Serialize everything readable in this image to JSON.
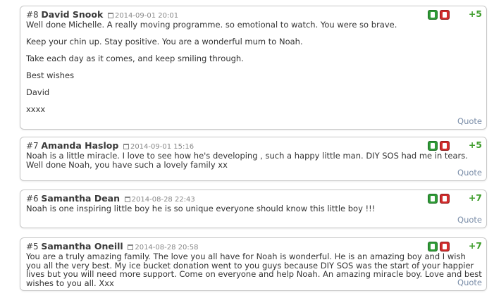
{
  "comments": [
    {
      "number": "#8",
      "author": "David Snook",
      "date": "2014-09-01 20:01",
      "score": "+5",
      "paragraphs": [
        "Well done Michelle. A really moving programme. so emotional to watch. You were so brave.",
        "Keep your chin up. Stay positive. You are a wonderful mum to Noah.",
        "Take each day as it comes, and keep smiling through.",
        "Best wishes",
        "David",
        "xxxx"
      ],
      "quote": "Quote"
    },
    {
      "number": "#7",
      "author": "Amanda Haslop",
      "date": "2014-09-01 15:16",
      "score": "+5",
      "paragraphs": [
        "Noah is a little miracle. I love to see how he's developing , such a happy little man. DIY SOS had me in tears. Well done Noah, you have such a lovely family xx"
      ],
      "quote": "Quote"
    },
    {
      "number": "#6",
      "author": "Samantha Dean",
      "date": "2014-08-28 22:43",
      "score": "+7",
      "paragraphs": [
        "Noah is one inspiring little boy he is so unique everyone should know this little boy !!!"
      ],
      "quote": "Quote"
    },
    {
      "number": "#5",
      "author": "Samantha Oneill",
      "date": "2014-08-28 20:58",
      "score": "+7",
      "paragraphs": [
        "You are a truly amazing family. The love you all have for Noah is wonderful. He is an amazing boy and I wish you all the very best. My ice bucket donation went to you guys because DIY SOS was the start of your happier lives but you will need more support. Come on everyone and help Noah. An amazing miracle boy. Love and best wishes to you all. Xxx"
      ],
      "quote": "Quote"
    }
  ],
  "icons": {
    "vote_up": "thumbs-up-icon",
    "vote_down": "thumbs-down-icon",
    "date": "calendar-icon"
  },
  "colors": {
    "score": "#3f9d2c",
    "vote_up": "#2e9a36",
    "vote_down": "#d12c2c",
    "quote_link": "#7a8da8"
  }
}
